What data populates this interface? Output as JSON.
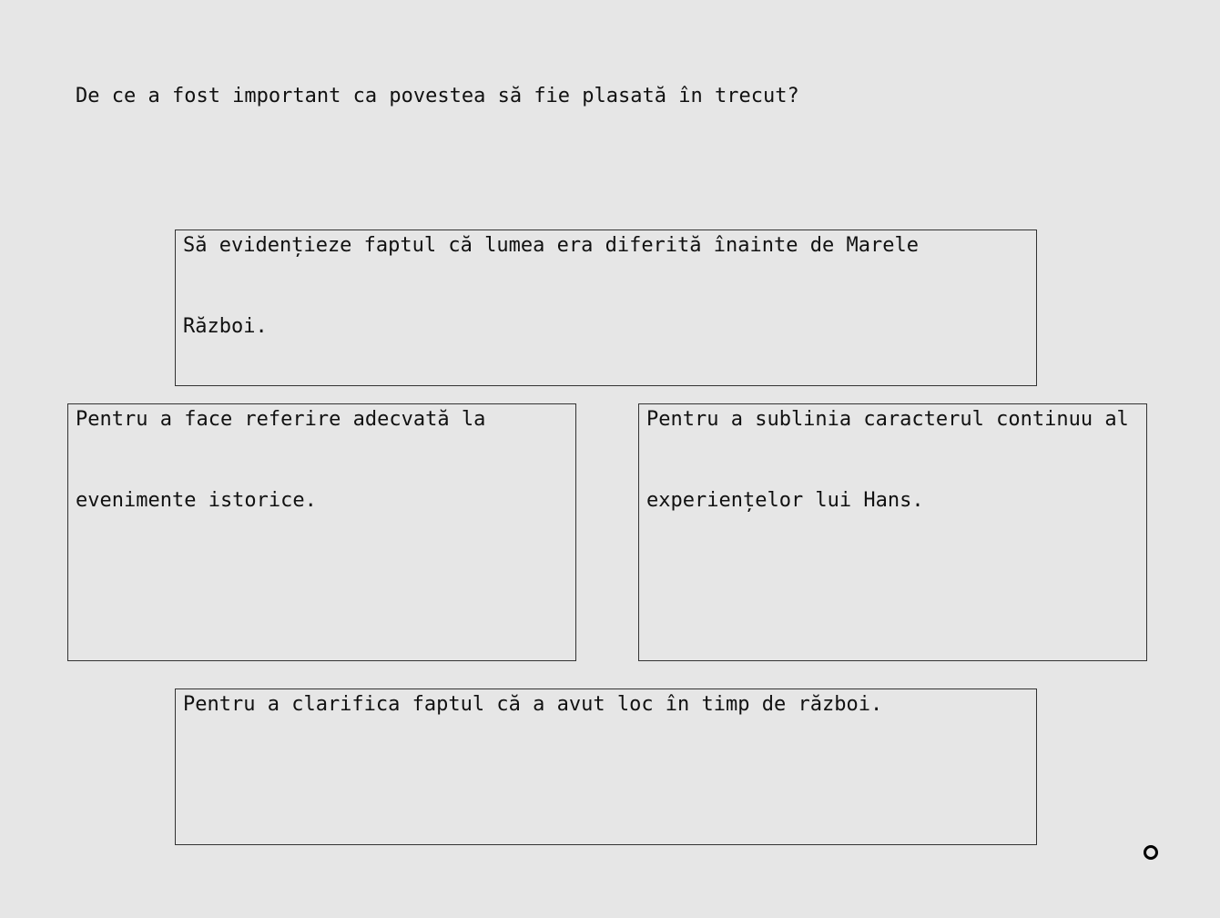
{
  "question": "De ce a fost important ca povestea să fie plasată în trecut?",
  "answers": [
    "Să evidențieze faptul că lumea era diferită înainte de Marele Război.",
    "Pentru a face referire adecvată la evenimente istorice.",
    "Pentru a sublinia caracterul continuu al experiențelor lui Hans.",
    "Pentru a clarifica faptul că a avut loc în timp de război."
  ],
  "icons": {
    "ring": "ring-icon"
  }
}
